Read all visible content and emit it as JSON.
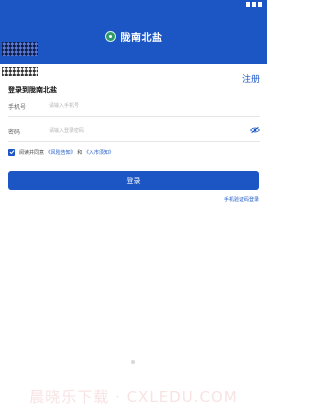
{
  "app": {
    "title": "陇南北盐"
  },
  "header": {
    "register_label": "注册"
  },
  "form": {
    "heading": "登录到陇南北盐",
    "phone": {
      "label": "手机号",
      "placeholder": "请输入手机号",
      "value": ""
    },
    "password": {
      "label": "密码",
      "placeholder": "请输入登录密码",
      "value": ""
    },
    "agreement": {
      "prefix": "阅读并同意",
      "link1": "《风险告知》",
      "connector": "和",
      "link2": "《入市须知》",
      "checked": true
    },
    "login_label": "登录",
    "sms_login_label": "手机验证码登录"
  },
  "watermark": "晨晓乐下载 · CXLEDU.COM",
  "colors": {
    "primary": "#1b56c4",
    "logo": "#2f9a6a"
  },
  "icons": [
    "logo-icon",
    "eye-off-icon",
    "checkmark-icon"
  ]
}
